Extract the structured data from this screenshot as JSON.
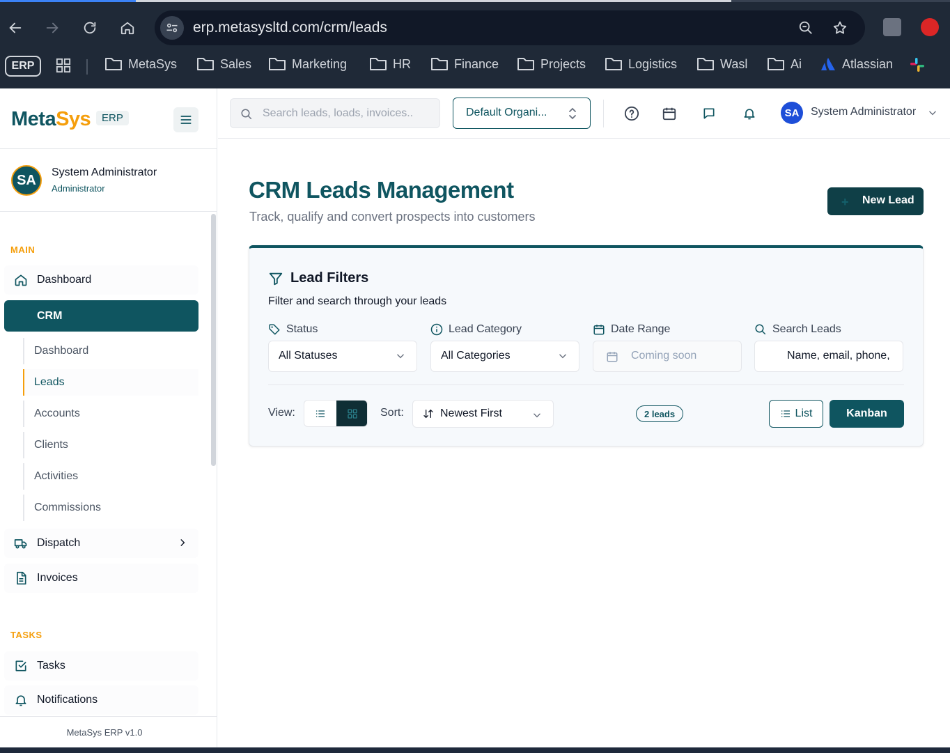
{
  "browser": {
    "url": "erp.metasysltd.com/crm/leads",
    "bookmarks": {
      "erp": "ERP",
      "items": [
        "MetaSys",
        "Sales",
        "Marketing",
        "HR",
        "Finance",
        "Projects",
        "Logistics",
        "Wasl",
        "Ai",
        "Atlassian"
      ]
    }
  },
  "sidebar": {
    "logo_meta": "Meta",
    "logo_sys": "Sys",
    "logo_badge": "ERP",
    "user": {
      "initials": "SA",
      "name": "System Administrator",
      "role": "Administrator"
    },
    "main_label": "MAIN",
    "dashboard": "Dashboard",
    "crm": "CRM",
    "crm_sub": [
      "Dashboard",
      "Leads",
      "Accounts",
      "Clients",
      "Activities",
      "Commissions"
    ],
    "dispatch": "Dispatch",
    "invoices": "Invoices",
    "tasks_label": "TASKS",
    "tasks": "Tasks",
    "notifications": "Notifications",
    "footer": "MetaSys ERP v1.0"
  },
  "header": {
    "search_placeholder": "Search leads, loads, invoices..",
    "org": "Default Organi...",
    "user_initials": "SA",
    "user_name": "System Administrator"
  },
  "page": {
    "title": "CRM Leads Management",
    "subtitle": "Track, qualify and convert prospects into customers",
    "new_lead": "New Lead"
  },
  "filters": {
    "title": "Lead Filters",
    "subtitle": "Filter and search through your leads",
    "status_label": "Status",
    "status_value": "All Statuses",
    "category_label": "Lead Category",
    "category_value": "All Categories",
    "date_label": "Date Range",
    "date_value": "Coming soon",
    "search_label": "Search Leads",
    "search_placeholder": "Name, email, phone,",
    "view_label": "View:",
    "sort_label": "Sort:",
    "sort_value": "Newest First",
    "count": "2 leads",
    "list_btn": "List",
    "kanban_btn": "Kanban"
  },
  "colors": {
    "brand": "#0f5560",
    "accent": "#f59e0b",
    "dark_button": "#0f3f47"
  }
}
